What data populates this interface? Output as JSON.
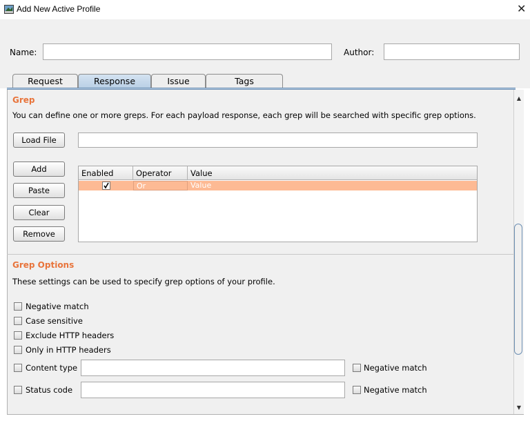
{
  "window": {
    "title": "Add New Active Profile",
    "close_glyph": "✕"
  },
  "form": {
    "name_label": "Name:",
    "name_value": "",
    "author_label": "Author:",
    "author_value": ""
  },
  "tabs": [
    {
      "label": "Request",
      "active": false
    },
    {
      "label": "Response",
      "active": true
    },
    {
      "label": "Issue",
      "active": false
    },
    {
      "label": "Tags",
      "active": false
    }
  ],
  "grep": {
    "title": "Grep",
    "description": "You can define one or more greps. For each payload response, each grep will be searched with specific grep options.",
    "load_file_label": "Load File",
    "load_file_path": "",
    "buttons": {
      "add": "Add",
      "paste": "Paste",
      "clear": "Clear",
      "remove": "Remove"
    },
    "table": {
      "columns": [
        "Enabled",
        "Operator",
        "Value"
      ],
      "rows": [
        {
          "enabled": true,
          "operator": "Or",
          "value": "Value"
        }
      ]
    }
  },
  "grep_options": {
    "title": "Grep Options",
    "description": "These settings can be used to specify grep options of your profile.",
    "checkboxes": {
      "negative_match": "Negative match",
      "case_sensitive": "Case sensitive",
      "exclude_http_headers": "Exclude HTTP headers",
      "only_in_http_headers": "Only in HTTP headers"
    },
    "content_type": {
      "label": "Content type",
      "value": "",
      "negative_label": "Negative match"
    },
    "status_code": {
      "label": "Status code",
      "value": "",
      "negative_label": "Negative match"
    }
  },
  "colors": {
    "accent": "#e8743b",
    "selected_row": "#fdba94",
    "active_tab": "#b8cfe5"
  },
  "icons": {
    "app": "burp-app-icon",
    "close": "close-icon",
    "check": "checkmark-icon"
  }
}
